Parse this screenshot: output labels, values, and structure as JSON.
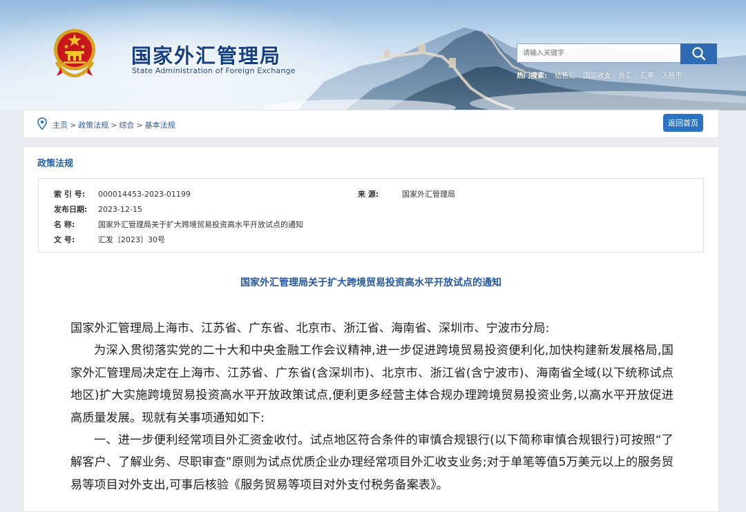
{
  "header": {
    "title_cn": "国家外汇管理局",
    "title_en": "State Administration of Foreign Exchange",
    "search_placeholder": "请输入关键字",
    "hot_label": "热门搜索:",
    "hot_keywords": [
      "结售汇",
      "国际收支",
      "外汇",
      "汇率",
      "人民币"
    ]
  },
  "breadcrumb": {
    "items": [
      "主页",
      "政策法规",
      "综合",
      "基本法规"
    ],
    "separator": ">",
    "back_label": "返回首页"
  },
  "section": {
    "title": "政策法规"
  },
  "meta": {
    "index_label": "索 引 号:",
    "index_value": "000014453-2023-01199",
    "source_label": "来 源:",
    "source_value": "国家外汇管理局",
    "date_label": "发布日期:",
    "date_value": "2023-12-15",
    "name_label": "名 称:",
    "name_value": "国家外汇管理局关于扩大跨境贸易投资高水平开放试点的通知",
    "docno_label": "文 号:",
    "docno_value": "汇发〔2023〕30号"
  },
  "doc": {
    "title": "国家外汇管理局关于扩大跨境贸易投资高水平开放试点的通知",
    "salutation": "国家外汇管理局上海市、江苏省、广东省、北京市、浙江省、海南省、深圳市、宁波市分局:",
    "para1": "为深入贯彻落实党的二十大和中央金融工作会议精神,进一步促进跨境贸易投资便利化,加快构建新发展格局,国家外汇管理局决定在上海市、江苏省、广东省(含深圳市)、北京市、浙江省(含宁波市)、海南省全域(以下统称试点地区)扩大实施跨境贸易投资高水平开放政策试点,便利更多经营主体合规办理跨境贸易投资业务,以高水平开放促进高质量发展。现就有关事项通知如下:",
    "para2": "一、进一步便利经常项目外汇资金收付。试点地区符合条件的审慎合规银行(以下简称审慎合规银行)可按照“了解客户、了解业务、尽职审查”原则为试点优质企业办理经常项目外汇收支业务;对于单笔等值5万美元以上的服务贸易等项目对外支出,可事后核验《服务贸易等项目对外支付税务备案表》。"
  },
  "colors": {
    "title_blue": "#143f84",
    "link_blue": "#2458a0",
    "button_blue": "#2b73c2"
  },
  "icons": {
    "emblem": "national-emblem-icon",
    "search": "search-icon",
    "location": "location-pin-icon"
  }
}
